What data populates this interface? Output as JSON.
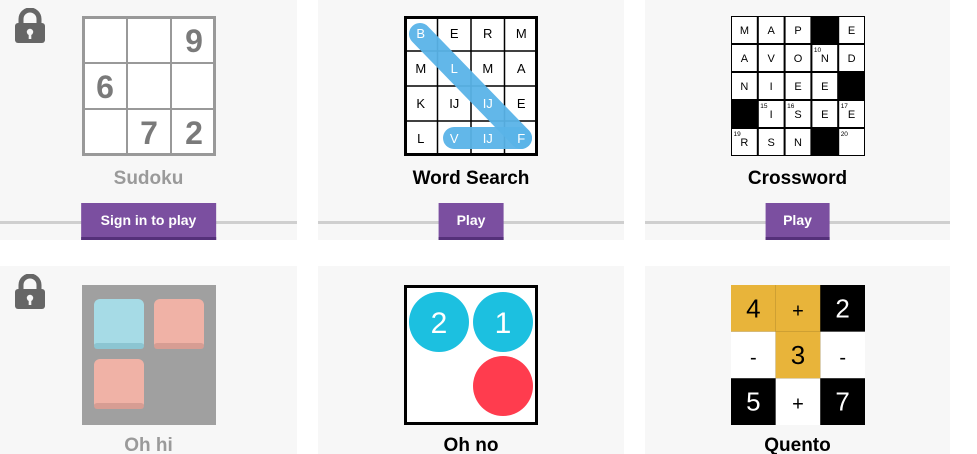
{
  "games": [
    {
      "title": "Sudoku",
      "button": "Sign in to play",
      "locked": true
    },
    {
      "title": "Word Search",
      "button": "Play",
      "locked": false
    },
    {
      "title": "Crossword",
      "button": "Play",
      "locked": false
    },
    {
      "title": "Oh hi",
      "locked": true
    },
    {
      "title": "Oh no",
      "locked": false
    },
    {
      "title": "Quento",
      "locked": false
    }
  ],
  "sudoku": {
    "digits": [
      "9",
      "6",
      "7",
      "2"
    ]
  },
  "wordsearch": {
    "grid": [
      "B",
      "E",
      "R",
      "M",
      "M",
      "L",
      "M",
      "A",
      "K",
      "IJ",
      "IJ",
      "E",
      "L",
      "V",
      "IJ",
      "F"
    ]
  },
  "crossword": {
    "cells": [
      "M",
      "A",
      "P",
      "E",
      "A",
      "V",
      "O",
      "N",
      "D",
      "N",
      "I",
      "E",
      "E",
      "I",
      "S",
      "E",
      "E",
      "R",
      "S",
      "N"
    ],
    "numbers": [
      "10",
      "15",
      "16",
      "17",
      "19",
      "20"
    ]
  },
  "ohno": {
    "circles": [
      "2",
      "1"
    ]
  },
  "quento": {
    "cells": [
      "4",
      "+",
      "2",
      "-",
      "3",
      "-",
      "5",
      "+",
      "7"
    ]
  },
  "colors": {
    "accent": "#7b4fa0",
    "card": "#f7f7f7",
    "wordsearch_highlight": "#5ab4e8",
    "ohno_blue": "#1cc0e0",
    "ohno_red": "#ff3c4e",
    "quento_gold": "#e8b43a",
    "ohhi_blue": "#a6dbe6",
    "ohhi_red": "#f0b2a6"
  }
}
